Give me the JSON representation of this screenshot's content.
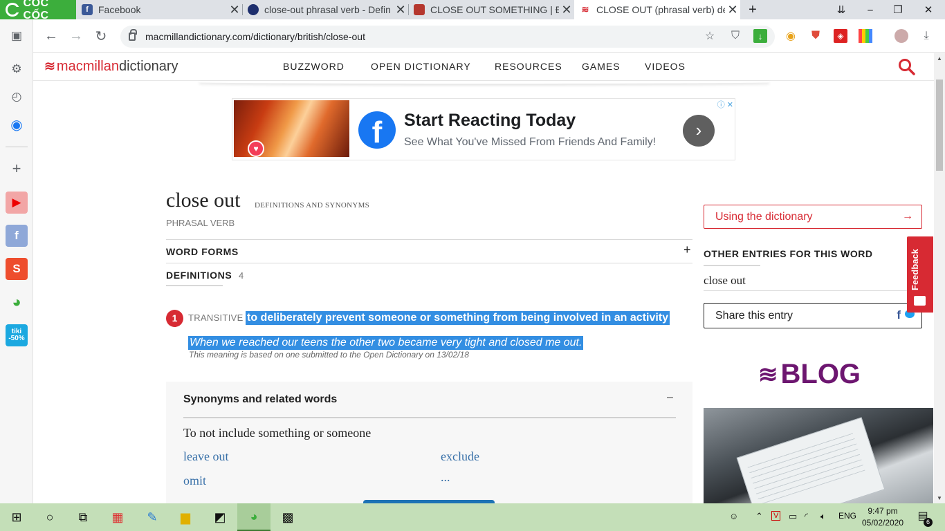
{
  "browser": {
    "brand": "CỐC CỐC",
    "tabs": [
      {
        "title": "Facebook",
        "favicon": "facebook-icon",
        "active": false
      },
      {
        "title": "close-out phrasal verb - Defin",
        "favicon": "oxford-icon",
        "active": false
      },
      {
        "title": "CLOSE OUT SOMETHING | Địn",
        "favicon": "cambridge-icon",
        "active": false
      },
      {
        "title": "CLOSE OUT (phrasal verb) def",
        "favicon": "macmillan-icon",
        "active": true
      }
    ],
    "url": "macmillandictionary.com/dictionary/british/close-out",
    "window_controls": {
      "minimize": "⎯",
      "restore": "❐",
      "close": "✕"
    }
  },
  "site": {
    "logo_brand": "macmillan",
    "logo_product": "dictionary",
    "nav": [
      "BUZZWORD",
      "OPEN DICTIONARY",
      "RESOURCES",
      "GAMES",
      "VIDEOS"
    ]
  },
  "ad": {
    "headline": "Start Reacting Today",
    "subline": "See What You've Missed From Friends And Family!"
  },
  "entry": {
    "headword": "close out",
    "headword_sub": "DEFINITIONS AND SYNONYMS",
    "part_of_speech": "PHRASAL VERB",
    "word_forms_label": "WORD FORMS",
    "word_forms_toggle": "+",
    "definitions_label": "DEFINITIONS",
    "definitions_count": "4",
    "senses": [
      {
        "number": "1",
        "grammar": "TRANSITIVE",
        "definition": "to deliberately prevent someone or something from being involved in an activity",
        "example": "When we reached our teens the other two became very tight and closed me out.",
        "note": "This meaning is based on one submitted to the Open Dictionary on 13/02/18"
      }
    ],
    "synonyms": {
      "title": "Synonyms and related words",
      "toggle": "–",
      "group": "To not include something or someone",
      "words": [
        "leave out",
        "exclude",
        "omit",
        "..."
      ]
    }
  },
  "sidebar": {
    "using_label": "Using the dictionary",
    "using_arrow": "→",
    "other_entries_title": "OTHER ENTRIES FOR THIS WORD",
    "other_entries": [
      "close out"
    ],
    "share_label": "Share this entry",
    "blog_label": "BLOG"
  },
  "feedback_label": "Feedback",
  "taskbar": {
    "language": "ENG",
    "time": "9:47 pm",
    "date": "05/02/2020",
    "notifications": "6"
  },
  "colors": {
    "macmillan_red": "#d72a33",
    "selection": "#338ee2",
    "blog_purple": "#6d1670",
    "link_blue": "#3870a8",
    "coccoc_green": "#3cae3c"
  }
}
